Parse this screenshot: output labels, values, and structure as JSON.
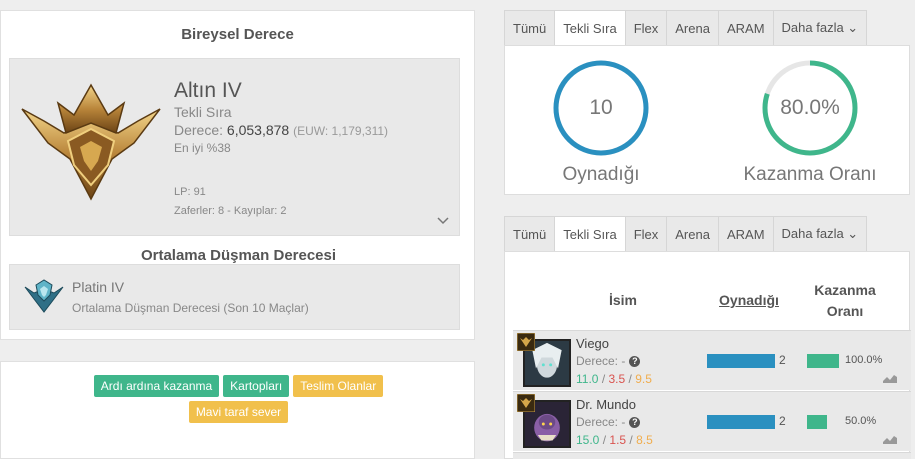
{
  "rank_card": {
    "title": "Bireysel Derece",
    "tier": "Altın IV",
    "queue": "Tekli Sıra",
    "lp_label": "Derece:",
    "lp_value": "6,053,878",
    "lp_euw": "(EUW: 1,179,311)",
    "top_percent": "En iyi %38",
    "lp": "LP: 91",
    "wins_losses": "Zaferler: 8 - Kayıplar: 2",
    "emblem_icon": "gold-emblem-icon",
    "expand_icon": "chevron-down-icon"
  },
  "avg_card": {
    "title": "Ortalama Düşman Derecesi",
    "tier": "Platin IV",
    "description": "Ortalama Düşman Derecesi (Son 10 Maçlar)",
    "emblem_icon": "platinum-emblem-icon"
  },
  "tags": [
    {
      "label": "Ardı ardına kazanma",
      "color": "#3fb68b"
    },
    {
      "label": "Kartopları",
      "color": "#3fb68b"
    },
    {
      "label": "Teslim Olanlar",
      "color": "#f1c04c"
    },
    {
      "label": "Mavi taraf sever",
      "color": "#f1c04c"
    }
  ],
  "tabs_top": {
    "items": [
      "Tümü",
      "Tekli Sıra",
      "Flex",
      "Arena",
      "ARAM",
      "Daha fazla ⌄"
    ],
    "active": 1
  },
  "stats": {
    "played_value": "10",
    "played_label": "Oynadığı",
    "played_fraction": 1.0,
    "played_color": "#2a90c0",
    "winrate_value": "80.0%",
    "winrate_label": "Kazanma Oranı",
    "winrate_fraction": 0.8,
    "winrate_color": "#3fb68b"
  },
  "tabs_bottom": {
    "items": [
      "Tümü",
      "Tekli Sıra",
      "Flex",
      "Arena",
      "ARAM",
      "Daha fazla ⌄"
    ],
    "active": 1
  },
  "champions": {
    "header": {
      "name": "İsim",
      "played": "Oynadığı",
      "winrate_line1": "Kazanma",
      "winrate_line2": "Oranı"
    },
    "rows": [
      {
        "name": "Viego",
        "rank": "Derece: -",
        "kills": "11.0",
        "deaths": "3.5",
        "assists": "9.5",
        "played": "2",
        "played_fraction": 1.0,
        "winrate": "100.0%",
        "winrate_fraction": 1.0
      },
      {
        "name": "Dr. Mundo",
        "rank": "Derece: -",
        "kills": "15.0",
        "deaths": "1.5",
        "assists": "8.5",
        "played": "2",
        "played_fraction": 1.0,
        "winrate": "50.0%",
        "winrate_fraction": 0.5
      }
    ]
  }
}
